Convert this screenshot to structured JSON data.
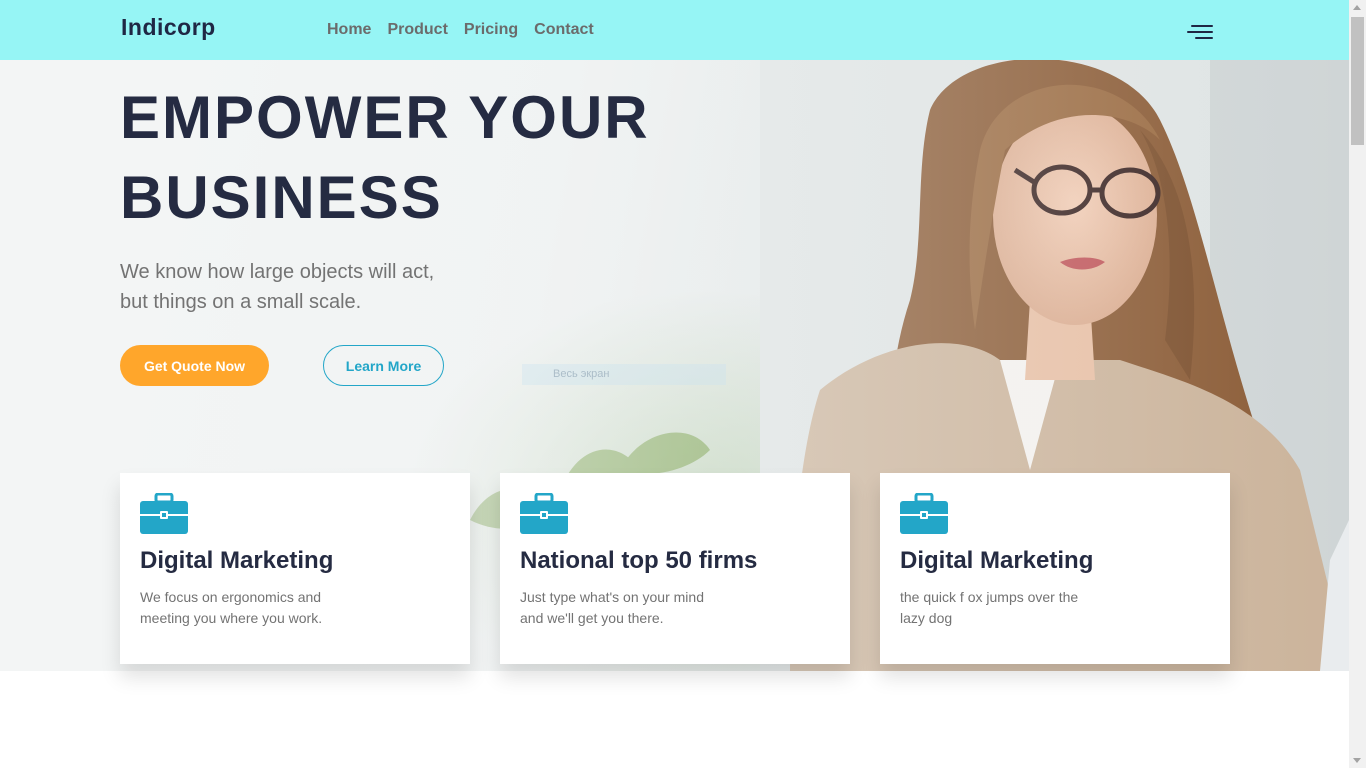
{
  "nav": {
    "brand": "Indicorp",
    "links": [
      "Home",
      "Product",
      "Pricing",
      "Contact"
    ]
  },
  "hero": {
    "title_line1": "EMPOWER YOUR",
    "title_line2": "BUSINESS",
    "subtitle_line1": "We know how large objects will act,",
    "subtitle_line2": "but things on a small scale.",
    "primary_button": "Get Quote Now",
    "secondary_button": "Learn More",
    "ghost_text": "Весь экран"
  },
  "cards": [
    {
      "title": "Digital Marketing",
      "text_line1": "We focus on ergonomics and",
      "text_line2": "meeting you where you work.",
      "icon": "briefcase-icon"
    },
    {
      "title": "National top 50 firms",
      "text_line1": "Just type what's on your mind",
      "text_line2": "and we'll get you there.",
      "icon": "briefcase-icon"
    },
    {
      "title": "Digital Marketing",
      "text_line1": "the quick f ox jumps over the",
      "text_line2": "lazy dog",
      "icon": "briefcase-icon"
    }
  ],
  "colors": {
    "navbar_bg": "#96f5f5",
    "heading": "#252b42",
    "accent_orange": "#ffa62b",
    "accent_blue": "#23a6c8",
    "muted_text": "#737373"
  }
}
